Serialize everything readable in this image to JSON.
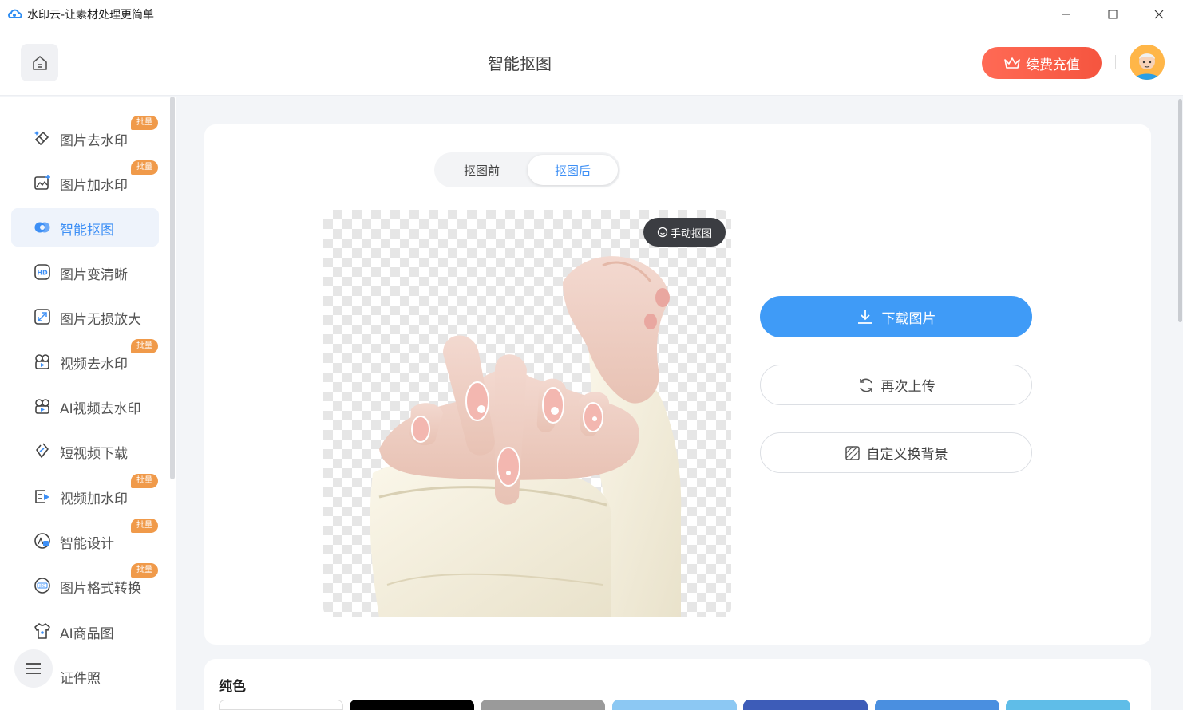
{
  "window": {
    "title": "水印云-让素材处理更简单",
    "controls": [
      "minimize-icon",
      "maximize-icon",
      "close-icon"
    ]
  },
  "header": {
    "page_title": "智能抠图",
    "vip_button": "续费充值"
  },
  "sidebar": {
    "items": [
      {
        "label": "图片去水印",
        "icon": "eraser-icon",
        "badge": "批量",
        "active": false
      },
      {
        "label": "图片加水印",
        "icon": "image-add-icon",
        "badge": "批量",
        "active": false
      },
      {
        "label": "智能抠图",
        "icon": "cutout-icon",
        "badge": "",
        "active": true
      },
      {
        "label": "图片变清晰",
        "icon": "hd-icon",
        "badge": "",
        "active": false
      },
      {
        "label": "图片无损放大",
        "icon": "enlarge-icon",
        "badge": "",
        "active": false
      },
      {
        "label": "视频去水印",
        "icon": "video-eraser-icon",
        "badge": "批量",
        "active": false
      },
      {
        "label": "AI视频去水印",
        "icon": "ai-video-eraser-icon",
        "badge": "",
        "active": false
      },
      {
        "label": "短视频下载",
        "icon": "link-icon",
        "badge": "",
        "active": false
      },
      {
        "label": "视频加水印",
        "icon": "video-add-icon",
        "badge": "批量",
        "active": false
      },
      {
        "label": "智能设计",
        "icon": "design-icon",
        "badge": "批量",
        "active": false
      },
      {
        "label": "图片格式转换",
        "icon": "jpg-convert-icon",
        "badge": "批量",
        "active": false
      },
      {
        "label": "AI商品图",
        "icon": "shirt-icon",
        "badge": "",
        "active": false
      },
      {
        "label": "证件照",
        "icon": "id-photo-icon",
        "badge": "",
        "active": false
      }
    ]
  },
  "main": {
    "tabs": [
      {
        "label": "抠图前",
        "selected": false
      },
      {
        "label": "抠图后",
        "selected": true
      }
    ],
    "manual_button": "手动抠图",
    "download_button": "下载图片",
    "reupload_button": "再次上传",
    "custom_bg_button": "自定义换背景"
  },
  "colors_section": {
    "title": "纯色",
    "swatches": [
      "#ffffff",
      "#000000",
      "#9a9a9a",
      "#8cc8f3",
      "#3d5cb8",
      "#4a8fe0",
      "#5fbde8"
    ]
  },
  "theme": {
    "accent": "#3f9bf7",
    "vip": "#f5553f",
    "badge": "#f09a4a"
  }
}
